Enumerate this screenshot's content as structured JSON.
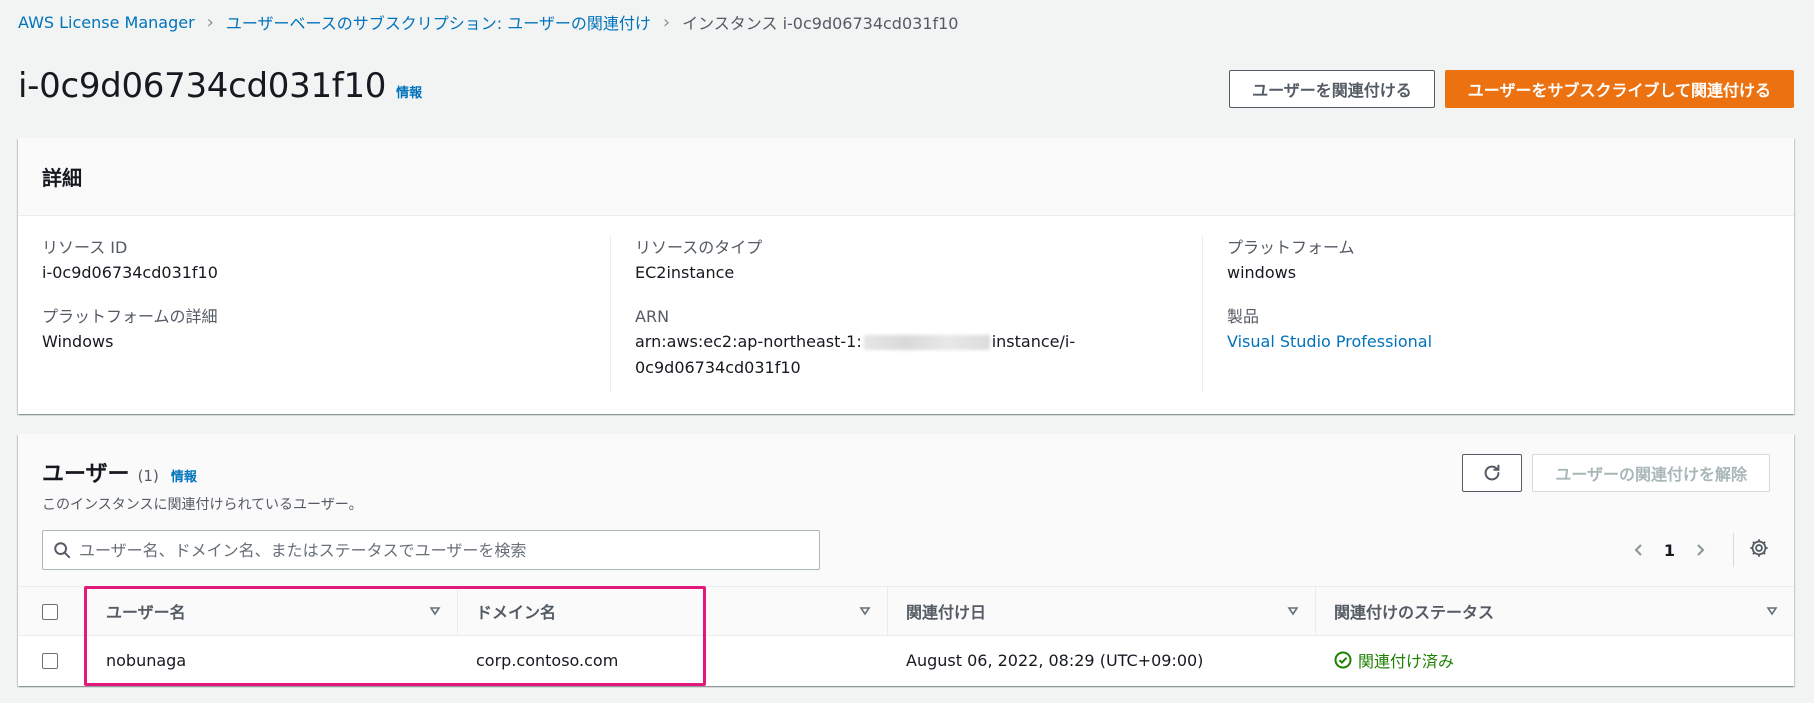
{
  "breadcrumb": [
    {
      "label": "AWS License Manager"
    },
    {
      "label": "ユーザーベースのサブスクリプション: ユーザーの関連付け"
    },
    {
      "label": "インスタンス i-0c9d06734cd031f10"
    }
  ],
  "header": {
    "title": "i-0c9d06734cd031f10",
    "info": "情報",
    "associate_button": "ユーザーを関連付ける",
    "subscribe_button": "ユーザーをサブスクライブして関連付ける"
  },
  "details": {
    "title": "詳細",
    "resource_id_label": "リソース ID",
    "resource_id": "i-0c9d06734cd031f10",
    "platform_detail_label": "プラットフォームの詳細",
    "platform_detail": "Windows",
    "resource_type_label": "リソースのタイプ",
    "resource_type": "EC2instance",
    "arn_label": "ARN",
    "arn_prefix": "arn:aws:ec2:ap-northeast-1:",
    "arn_suffix": "instance/i-",
    "arn_line2": "0c9d06734cd031f10",
    "platform_label": "プラットフォーム",
    "platform": "windows",
    "product_label": "製品",
    "product": "Visual Studio Professional"
  },
  "users": {
    "title": "ユーザー",
    "count": "(1)",
    "info": "情報",
    "description": "このインスタンスに関連付けられているユーザー。",
    "disassociate_button": "ユーザーの関連付けを解除",
    "search_placeholder": "ユーザー名、ドメイン名、またはステータスでユーザーを検索",
    "page": "1",
    "columns": [
      "ユーザー名",
      "ドメイン名",
      "関連付け日",
      "関連付けのステータス"
    ],
    "rows": [
      {
        "username": "nobunaga",
        "domain": "corp.contoso.com",
        "date": "August 06, 2022, 08:29 (UTC+09:00)",
        "status": "関連付け済み"
      }
    ]
  },
  "colors": {
    "primary": "#ec7211",
    "link": "#0073bb",
    "success": "#1d8102",
    "highlight": "#e2187a"
  },
  "icons": {
    "refresh": "refresh-icon",
    "search": "search-icon",
    "settings": "gear-icon",
    "status": "check-circle-icon"
  }
}
